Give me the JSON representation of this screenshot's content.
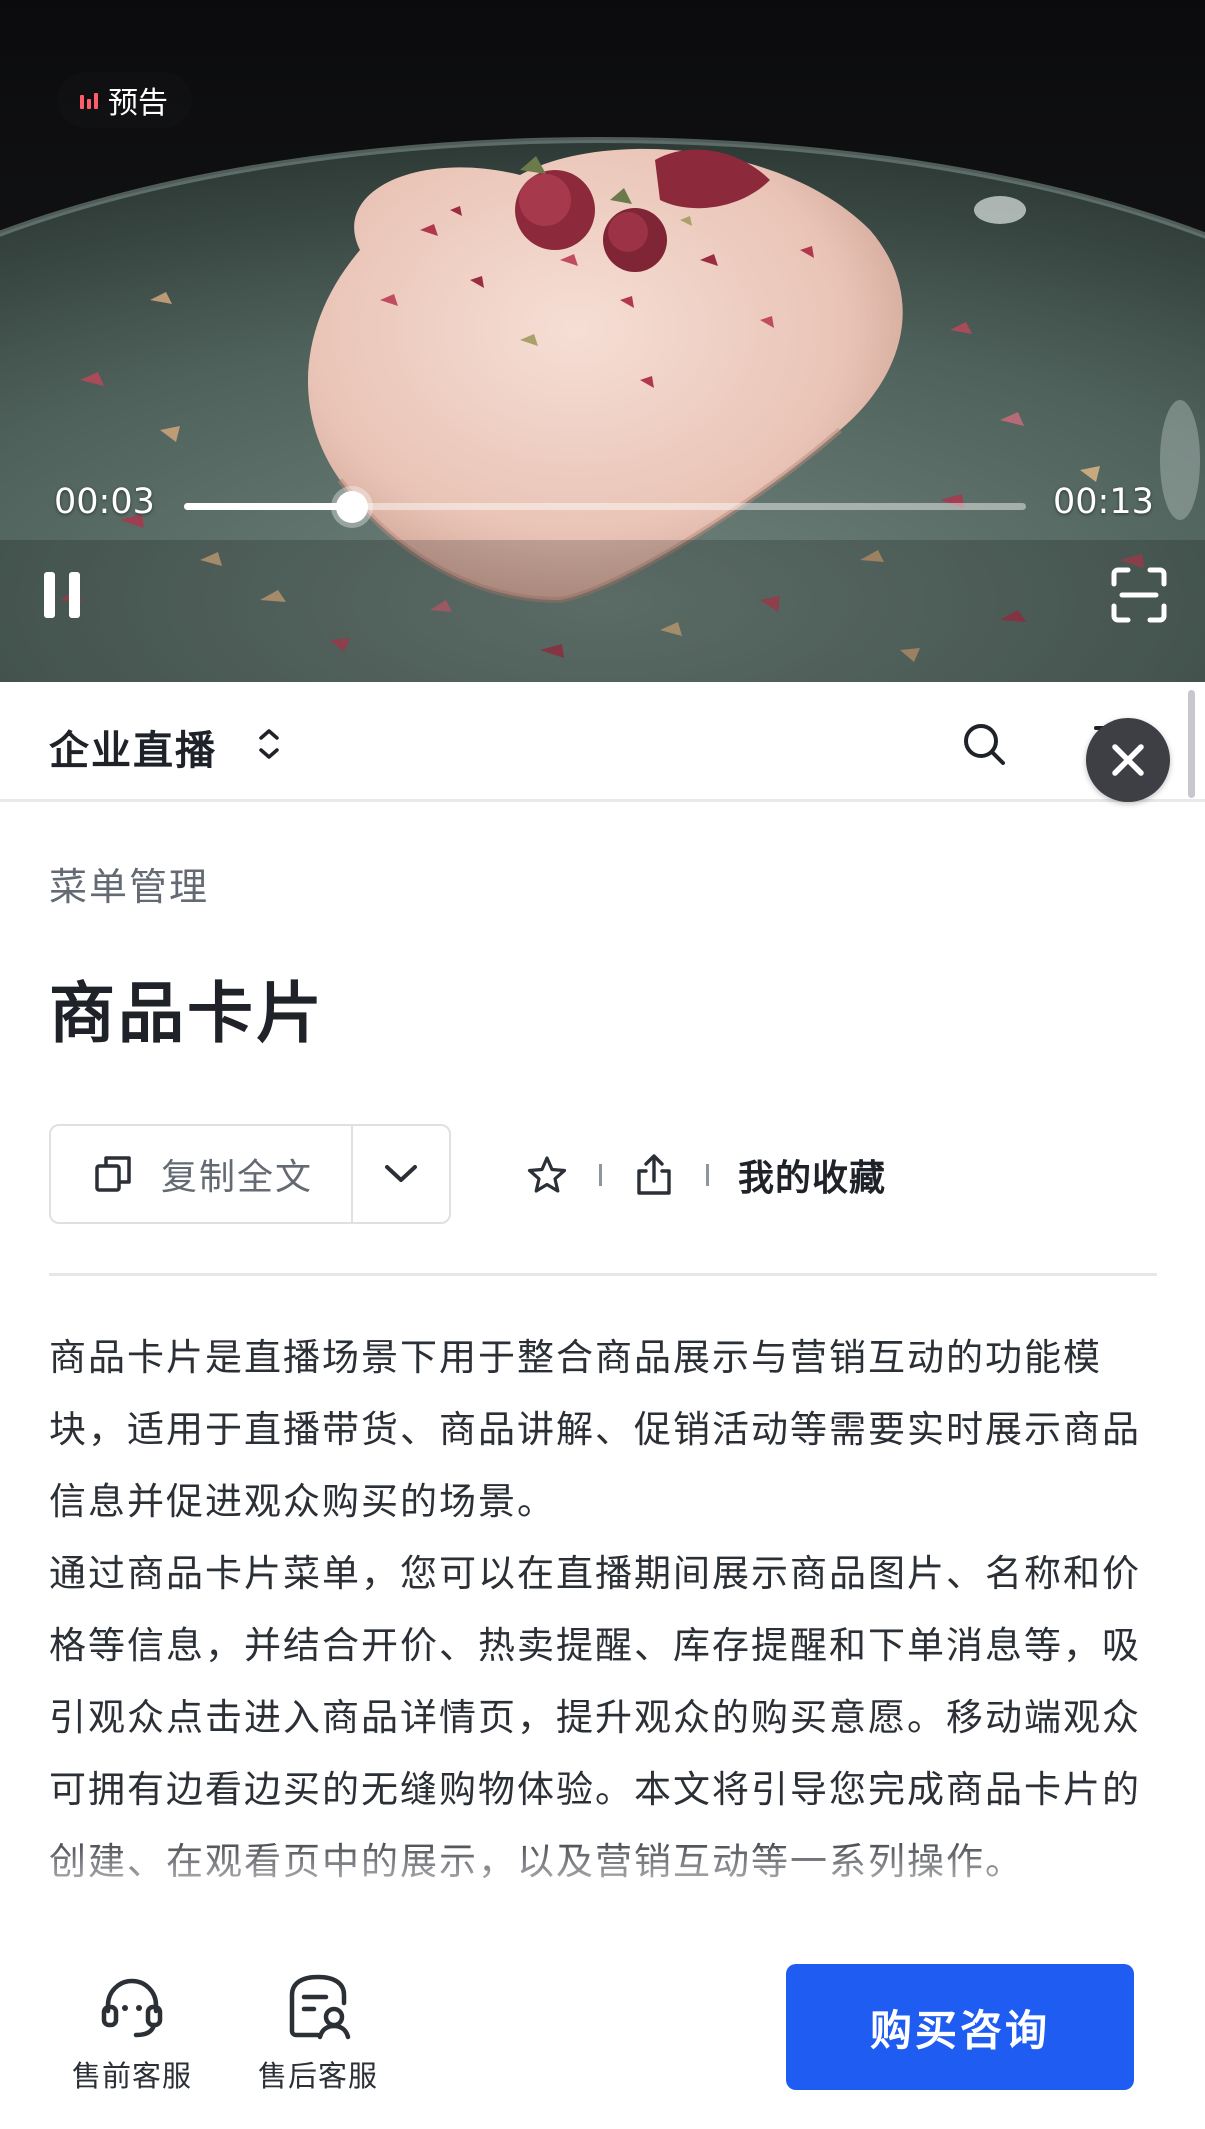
{
  "video": {
    "badge": "预告",
    "current_time": "00:03",
    "total_time": "00:13",
    "progress": 0.2,
    "scene": "heart-shaped rose mousse cake on green plate",
    "colors": {
      "badge_bars": "#ff5c6c"
    }
  },
  "nav": {
    "title": "企业直播",
    "icons": [
      "switch-arrows-icon",
      "search-icon",
      "menu-icon",
      "close-icon"
    ]
  },
  "doc": {
    "breadcrumb": "菜单管理",
    "title": "商品卡片",
    "copy_label": "复制全文",
    "favorites_label": "我的收藏",
    "paragraphs": [
      "商品卡片是直播场景下用于整合商品展示与营销互动的功能模块，适用于直播带货、商品讲解、促销活动等需要实时展示商品信息并促进观众购买的场景。",
      "通过商品卡片菜单，您可以在直播期间展示商品图片、名称和价格等信息，并结合开价、热卖提醒、库存提醒和下单消息等，吸引观众点击进入商品详情页，提升观众的购买意愿。移动端观众可拥有边看边买的无缝购物体验。本文将引导您完成商品卡片的创建、在观看页中的展示，以及营销互动等一系列操作。"
    ]
  },
  "bottom": {
    "presale_label": "售前客服",
    "aftersale_label": "售后客服",
    "buy_label": "购买咨询",
    "colors": {
      "primary": "#1f5cf1"
    }
  }
}
